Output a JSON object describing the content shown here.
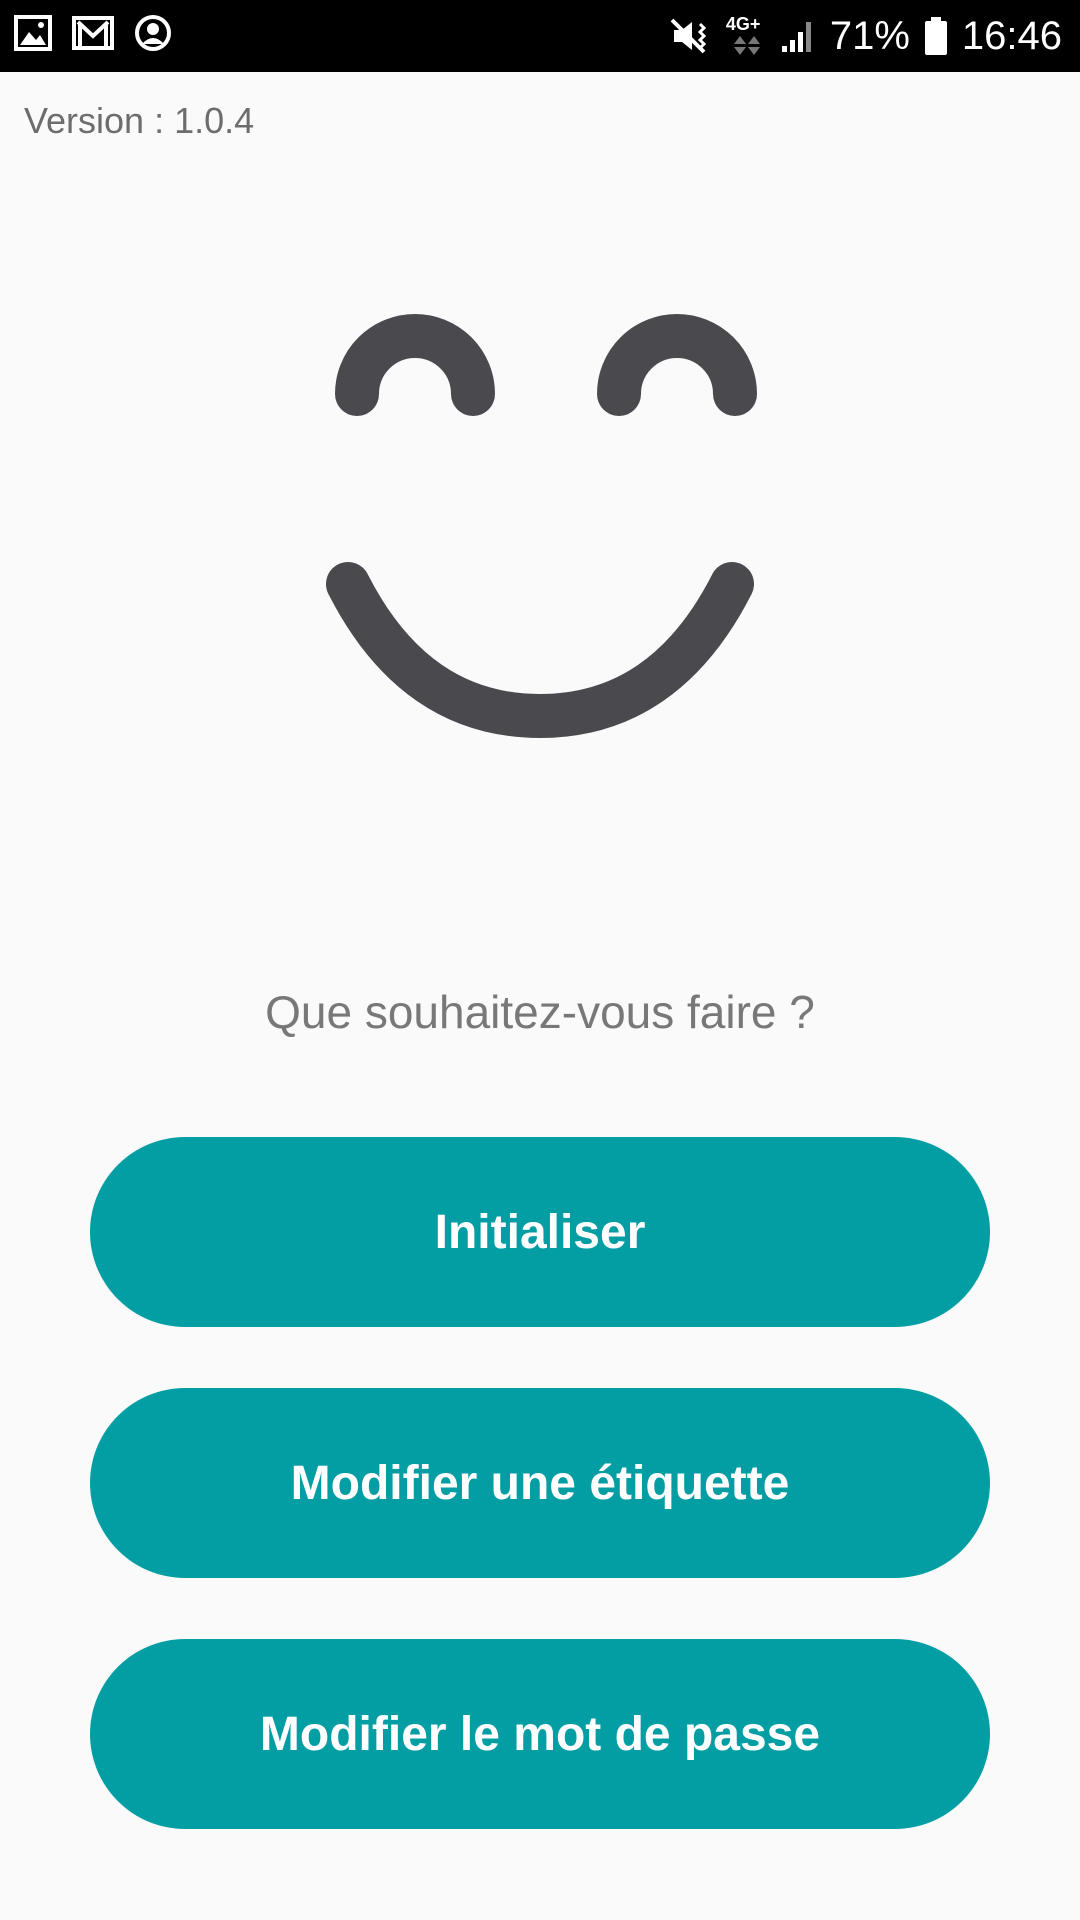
{
  "status_bar": {
    "battery_percent": "71%",
    "time": "16:46",
    "network_label": "4G+",
    "icons": [
      "gallery-icon",
      "gmail-icon",
      "account-icon",
      "mute-vibrate-icon",
      "network-4g-icon",
      "signal-icon",
      "battery-icon"
    ]
  },
  "version_label": "Version : 1.0.4",
  "illustration": "smiley-face-icon",
  "prompt": "Que souhaitez-vous faire ?",
  "actions": {
    "initialize": "Initialiser",
    "edit_label": "Modifier une étiquette",
    "change_password": "Modifier le mot de passe"
  },
  "colors": {
    "accent": "#039ea3",
    "status_bar": "#000000",
    "background": "#fafafa",
    "smiley": "#4a494d",
    "text_muted": "#787878"
  }
}
